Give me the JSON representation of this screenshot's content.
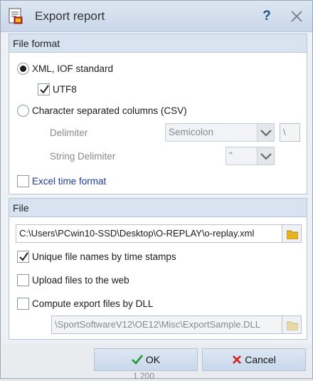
{
  "window": {
    "title": "Export report",
    "help_label": "?"
  },
  "file_format": {
    "header": "File format",
    "xml_label": "XML, IOF standard",
    "utf8_label": "UTF8",
    "csv_label": "Character separated columns (CSV)",
    "delimiter_label": "Delimiter",
    "delimiter_value": "Semicolon",
    "delimiter_char": "\\",
    "string_delimiter_label": "String Delimiter",
    "string_delimiter_value": "\"",
    "excel_time_label": "Excel time format"
  },
  "file": {
    "header": "File",
    "path": "C:\\Users\\PCwin10-SSD\\Desktop\\O-REPLAY\\o-replay.xml",
    "unique_names_label": "Unique file names by time stamps",
    "upload_label": "Upload files to the web",
    "dll_label": "Compute export files by DLL",
    "dll_path": "\\SportSoftwareV12\\OE12\\Misc\\ExportSample.DLL"
  },
  "buttons": {
    "ok": "OK",
    "cancel": "Cancel"
  },
  "background_text": "1 200",
  "colors": {
    "ok_green": "#1f9a2e",
    "cancel_red": "#d21f1f",
    "link_blue": "#1a3c9a"
  }
}
